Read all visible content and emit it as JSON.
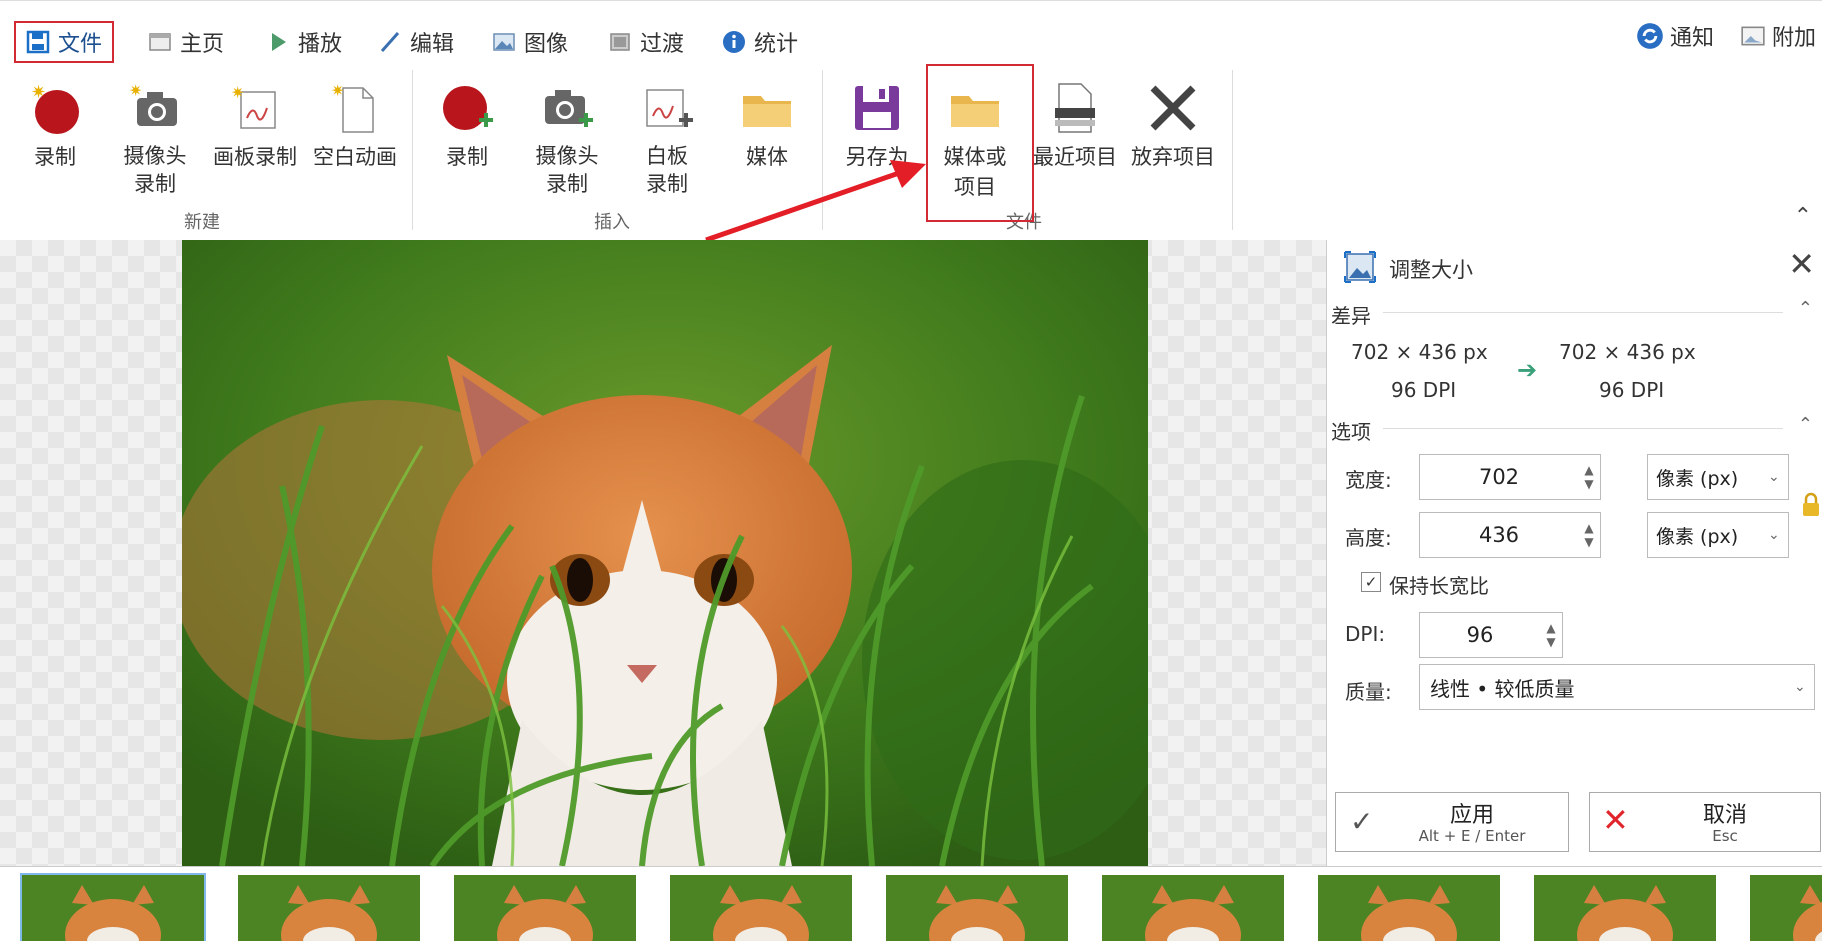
{
  "tabs": [
    {
      "label": "文件",
      "icon": "save-icon"
    },
    {
      "label": "主页",
      "icon": "home-icon"
    },
    {
      "label": "播放",
      "icon": "play-icon"
    },
    {
      "label": "编辑",
      "icon": "edit-icon"
    },
    {
      "label": "图像",
      "icon": "image-icon"
    },
    {
      "label": "过渡",
      "icon": "transition-icon"
    },
    {
      "label": "统计",
      "icon": "info-icon"
    }
  ],
  "right_tabs": [
    {
      "label": "通知",
      "icon": "refresh-icon"
    },
    {
      "label": "附加",
      "icon": "extras-icon"
    }
  ],
  "ribbon": {
    "new_group": {
      "label": "新建",
      "items": [
        "录制",
        "摄像头\n录制",
        "画板录制",
        "空白动画"
      ]
    },
    "insert_group": {
      "label": "插入",
      "items": [
        "录制",
        "摄像头\n录制",
        "白板\n录制",
        "媒体"
      ]
    },
    "file_group": {
      "label": "文件",
      "items": [
        "另存为",
        "媒体或\n项目",
        "最近项目",
        "放弃项目"
      ]
    }
  },
  "panel": {
    "title": "调整大小",
    "diff_section": "差异",
    "before_size": "702 × 436 px",
    "before_dpi": "96 DPI",
    "after_size": "702 × 436 px",
    "after_dpi": "96 DPI",
    "options_section": "选项",
    "width_label": "宽度:",
    "width_value": "702",
    "width_unit": "像素 (px)",
    "height_label": "高度:",
    "height_value": "436",
    "height_unit": "像素 (px)",
    "keep_ratio_label": "保持长宽比",
    "keep_ratio_checked": true,
    "dpi_label": "DPI:",
    "dpi_value": "96",
    "quality_label": "质量:",
    "quality_value": "线性 • 较低质量",
    "apply_label": "应用",
    "apply_shortcut": "Alt + E / Enter",
    "cancel_label": "取消",
    "cancel_shortcut": "Esc"
  },
  "colors": {
    "accent": "#1c6fc7",
    "highlight": "#d12a33",
    "record_red": "#b8161c",
    "folder": "#f0c060",
    "saveas_purple": "#7a3a9c"
  },
  "strip": {
    "frame_count": 9
  }
}
